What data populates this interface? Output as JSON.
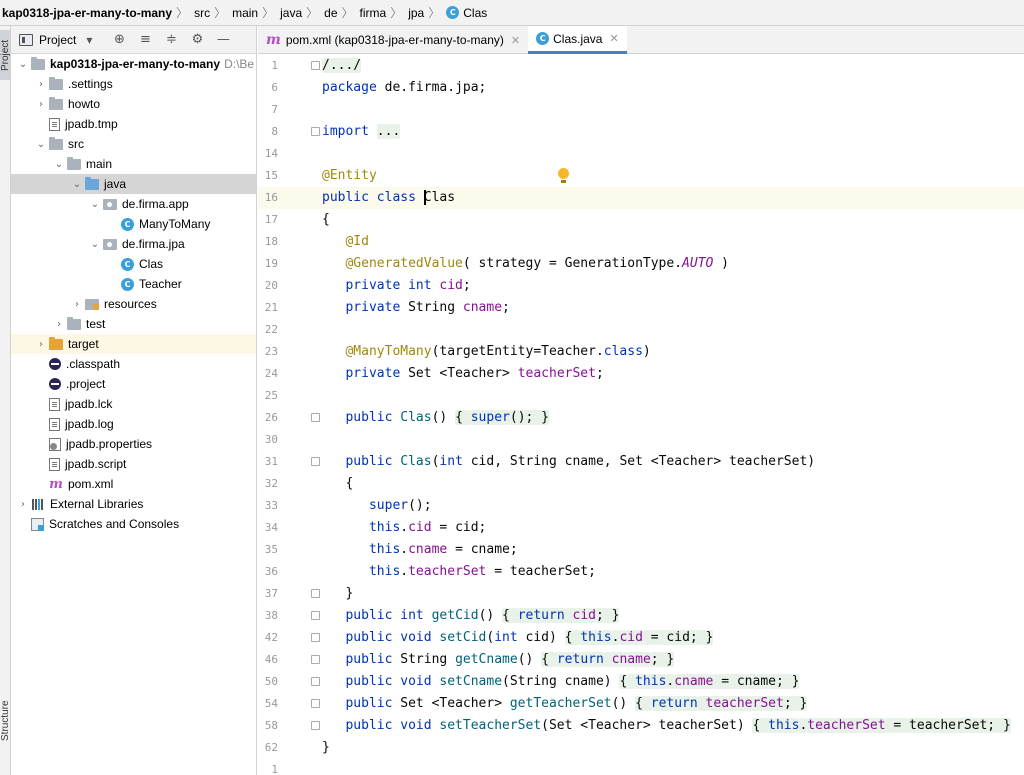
{
  "breadcrumb": [
    "kap0318-jpa-er-many-to-many",
    "src",
    "main",
    "java",
    "de",
    "firma",
    "jpa",
    "Clas"
  ],
  "left_stripe": {
    "project_label": "Project",
    "structure_label": "Structure"
  },
  "project_panel": {
    "title": "Project",
    "dropdown_glyph": "▾",
    "tools": [
      "⊕",
      "≡",
      "≑",
      "⚙",
      "—"
    ],
    "tree": [
      {
        "depth": 0,
        "arrow": "⌄",
        "icon": "folder",
        "label": "kap0318-jpa-er-many-to-many",
        "bold": true,
        "hint": "D:\\Be"
      },
      {
        "depth": 1,
        "arrow": "›",
        "icon": "folder",
        "label": ".settings"
      },
      {
        "depth": 1,
        "arrow": "›",
        "icon": "folder",
        "label": "howto"
      },
      {
        "depth": 1,
        "arrow": "",
        "icon": "file",
        "label": "jpadb.tmp"
      },
      {
        "depth": 1,
        "arrow": "⌄",
        "icon": "folder",
        "label": "src"
      },
      {
        "depth": 2,
        "arrow": "⌄",
        "icon": "folder",
        "label": "main"
      },
      {
        "depth": 3,
        "arrow": "⌄",
        "icon": "folder-blue",
        "label": "java",
        "selected": true
      },
      {
        "depth": 4,
        "arrow": "⌄",
        "icon": "package",
        "label": "de.firma.app"
      },
      {
        "depth": 5,
        "arrow": "",
        "icon": "class",
        "label": "ManyToMany"
      },
      {
        "depth": 4,
        "arrow": "⌄",
        "icon": "package",
        "label": "de.firma.jpa"
      },
      {
        "depth": 5,
        "arrow": "",
        "icon": "class",
        "label": "Clas"
      },
      {
        "depth": 5,
        "arrow": "",
        "icon": "class",
        "label": "Teacher"
      },
      {
        "depth": 3,
        "arrow": "›",
        "icon": "resources",
        "label": "resources"
      },
      {
        "depth": 2,
        "arrow": "›",
        "icon": "folder",
        "label": "test"
      },
      {
        "depth": 1,
        "arrow": "›",
        "icon": "folder-orange",
        "label": "target",
        "highlight": true
      },
      {
        "depth": 1,
        "arrow": "",
        "icon": "eclipse",
        "label": ".classpath"
      },
      {
        "depth": 1,
        "arrow": "",
        "icon": "eclipse",
        "label": ".project"
      },
      {
        "depth": 1,
        "arrow": "",
        "icon": "file",
        "label": "jpadb.lck"
      },
      {
        "depth": 1,
        "arrow": "",
        "icon": "file",
        "label": "jpadb.log"
      },
      {
        "depth": 1,
        "arrow": "",
        "icon": "gear-file",
        "label": "jpadb.properties"
      },
      {
        "depth": 1,
        "arrow": "",
        "icon": "file",
        "label": "jpadb.script"
      },
      {
        "depth": 1,
        "arrow": "",
        "icon": "maven",
        "label": "pom.xml"
      },
      {
        "depth": 0,
        "arrow": "›",
        "icon": "libraries",
        "label": "External Libraries"
      },
      {
        "depth": 0,
        "arrow": "",
        "icon": "scratch",
        "label": "Scratches and Consoles"
      }
    ]
  },
  "editor_tabs": [
    {
      "icon": "m",
      "label": "pom.xml (kap0318-jpa-er-many-to-many)",
      "close": "✕",
      "active": false
    },
    {
      "icon": "class",
      "label": "Clas.java",
      "close": "✕",
      "active": true
    }
  ],
  "editor": {
    "current_line": 16,
    "lines": [
      {
        "n": "1",
        "fold": "plus",
        "segs": [
          [
            "fold",
            "/.../"
          ]
        ]
      },
      {
        "n": "6",
        "segs": [
          [
            "kw",
            "package"
          ],
          [
            "",
            " de.firma.jpa;"
          ]
        ]
      },
      {
        "n": "7",
        "segs": []
      },
      {
        "n": "8",
        "fold": "plus",
        "segs": [
          [
            "kw",
            "import"
          ],
          [
            "",
            " "
          ],
          [
            "fold",
            "..."
          ]
        ]
      },
      {
        "n": "14",
        "segs": []
      },
      {
        "n": "15",
        "segs": [
          [
            "ann",
            "@Entity"
          ]
        ]
      },
      {
        "n": "16",
        "caret_before": "Clas",
        "segs": [
          [
            "kw",
            "public class"
          ],
          [
            "",
            " "
          ],
          [
            "caret",
            ""
          ],
          [
            "",
            "Clas"
          ]
        ]
      },
      {
        "n": "17",
        "segs": [
          [
            "",
            "{"
          ]
        ]
      },
      {
        "n": "18",
        "segs": [
          [
            "",
            "   "
          ],
          [
            "ann",
            "@Id"
          ]
        ]
      },
      {
        "n": "19",
        "segs": [
          [
            "",
            "   "
          ],
          [
            "ann",
            "@GeneratedValue"
          ],
          [
            "",
            "( strategy = GenerationType."
          ],
          [
            "it",
            "AUTO"
          ],
          [
            "",
            " )"
          ]
        ]
      },
      {
        "n": "20",
        "segs": [
          [
            "",
            "   "
          ],
          [
            "kw",
            "private int"
          ],
          [
            "",
            " "
          ],
          [
            "fld",
            "cid"
          ],
          [
            "",
            ";"
          ]
        ]
      },
      {
        "n": "21",
        "segs": [
          [
            "",
            "   "
          ],
          [
            "kw",
            "private"
          ],
          [
            "",
            " String "
          ],
          [
            "fld",
            "cname"
          ],
          [
            "",
            ";"
          ]
        ]
      },
      {
        "n": "22",
        "segs": []
      },
      {
        "n": "23",
        "segs": [
          [
            "",
            "   "
          ],
          [
            "ann",
            "@ManyToMany"
          ],
          [
            "",
            "(targetEntity=Teacher."
          ],
          [
            "kw",
            "class"
          ],
          [
            "",
            ")"
          ]
        ]
      },
      {
        "n": "24",
        "segs": [
          [
            "",
            "   "
          ],
          [
            "kw",
            "private"
          ],
          [
            "",
            " Set <Teacher> "
          ],
          [
            "fld",
            "teacherSet"
          ],
          [
            "",
            ";"
          ]
        ]
      },
      {
        "n": "25",
        "segs": []
      },
      {
        "n": "26",
        "fold": "plus",
        "segs": [
          [
            "",
            "   "
          ],
          [
            "kw",
            "public"
          ],
          [
            "",
            " "
          ],
          [
            "meth",
            "Clas"
          ],
          [
            "",
            "() "
          ],
          [
            "fold",
            "{ "
          ],
          [
            "kwfold",
            "super"
          ],
          [
            "fold",
            "(); }"
          ]
        ]
      },
      {
        "n": "30",
        "segs": []
      },
      {
        "n": "31",
        "fold": "minus",
        "segs": [
          [
            "",
            "   "
          ],
          [
            "kw",
            "public"
          ],
          [
            "",
            " "
          ],
          [
            "meth",
            "Clas"
          ],
          [
            "",
            "("
          ],
          [
            "kw",
            "int"
          ],
          [
            "",
            " cid, String cname, Set <Teacher> teacherSet)"
          ]
        ]
      },
      {
        "n": "32",
        "segs": [
          [
            "",
            "   {"
          ]
        ]
      },
      {
        "n": "33",
        "segs": [
          [
            "",
            "      "
          ],
          [
            "kw",
            "super"
          ],
          [
            "",
            "();"
          ]
        ]
      },
      {
        "n": "34",
        "segs": [
          [
            "",
            "      "
          ],
          [
            "kw",
            "this"
          ],
          [
            "",
            "."
          ],
          [
            "fld",
            "cid"
          ],
          [
            "",
            " = cid;"
          ]
        ]
      },
      {
        "n": "35",
        "segs": [
          [
            "",
            "      "
          ],
          [
            "kw",
            "this"
          ],
          [
            "",
            "."
          ],
          [
            "fld",
            "cname"
          ],
          [
            "",
            " = cname;"
          ]
        ]
      },
      {
        "n": "36",
        "segs": [
          [
            "",
            "      "
          ],
          [
            "kw",
            "this"
          ],
          [
            "",
            "."
          ],
          [
            "fld",
            "teacherSet"
          ],
          [
            "",
            " = teacherSet;"
          ]
        ]
      },
      {
        "n": "37",
        "fold": "minus",
        "segs": [
          [
            "",
            "   }"
          ]
        ]
      },
      {
        "n": "38",
        "fold": "plus",
        "segs": [
          [
            "",
            "   "
          ],
          [
            "kw",
            "public int"
          ],
          [
            "",
            " "
          ],
          [
            "meth",
            "getCid"
          ],
          [
            "",
            "() "
          ],
          [
            "fold",
            "{ "
          ],
          [
            "kwfold",
            "return"
          ],
          [
            "fldfold",
            " cid"
          ],
          [
            "fold",
            "; }"
          ]
        ]
      },
      {
        "n": "42",
        "fold": "plus",
        "segs": [
          [
            "",
            "   "
          ],
          [
            "kw",
            "public void"
          ],
          [
            "",
            " "
          ],
          [
            "meth",
            "setCid"
          ],
          [
            "",
            "("
          ],
          [
            "kw",
            "int"
          ],
          [
            "",
            " cid) "
          ],
          [
            "fold",
            "{ "
          ],
          [
            "kwfold",
            "this"
          ],
          [
            "fold",
            "."
          ],
          [
            "fldfold",
            "cid"
          ],
          [
            "fold",
            " = cid; }"
          ]
        ]
      },
      {
        "n": "46",
        "fold": "plus",
        "segs": [
          [
            "",
            "   "
          ],
          [
            "kw",
            "public"
          ],
          [
            "",
            " String "
          ],
          [
            "meth",
            "getCname"
          ],
          [
            "",
            "() "
          ],
          [
            "fold",
            "{ "
          ],
          [
            "kwfold",
            "return"
          ],
          [
            "fldfold",
            " cname"
          ],
          [
            "fold",
            "; }"
          ]
        ]
      },
      {
        "n": "50",
        "fold": "plus",
        "segs": [
          [
            "",
            "   "
          ],
          [
            "kw",
            "public void"
          ],
          [
            "",
            " "
          ],
          [
            "meth",
            "setCname"
          ],
          [
            "",
            "(String cname) "
          ],
          [
            "fold",
            "{ "
          ],
          [
            "kwfold",
            "this"
          ],
          [
            "fold",
            "."
          ],
          [
            "fldfold",
            "cname"
          ],
          [
            "fold",
            " = cname; }"
          ]
        ]
      },
      {
        "n": "54",
        "fold": "plus",
        "segs": [
          [
            "",
            "   "
          ],
          [
            "kw",
            "public"
          ],
          [
            "",
            " Set <Teacher> "
          ],
          [
            "meth",
            "getTeacherSet"
          ],
          [
            "",
            "() "
          ],
          [
            "fold",
            "{ "
          ],
          [
            "kwfold",
            "return"
          ],
          [
            "fldfold",
            " teacherSet"
          ],
          [
            "fold",
            "; }"
          ]
        ]
      },
      {
        "n": "58",
        "fold": "plus",
        "segs": [
          [
            "",
            "   "
          ],
          [
            "kw",
            "public void"
          ],
          [
            "",
            " "
          ],
          [
            "meth",
            "setTeacherSet"
          ],
          [
            "",
            "(Set <Teacher> teacherSet) "
          ],
          [
            "fold",
            "{ "
          ],
          [
            "kwfold",
            "this"
          ],
          [
            "fold",
            "."
          ],
          [
            "fldfold",
            "teacherSet"
          ],
          [
            "fold",
            " = teacherSet; }"
          ]
        ]
      },
      {
        "n": "62",
        "segs": [
          [
            "",
            "}"
          ]
        ]
      },
      {
        "n": "1",
        "segs": []
      }
    ]
  }
}
